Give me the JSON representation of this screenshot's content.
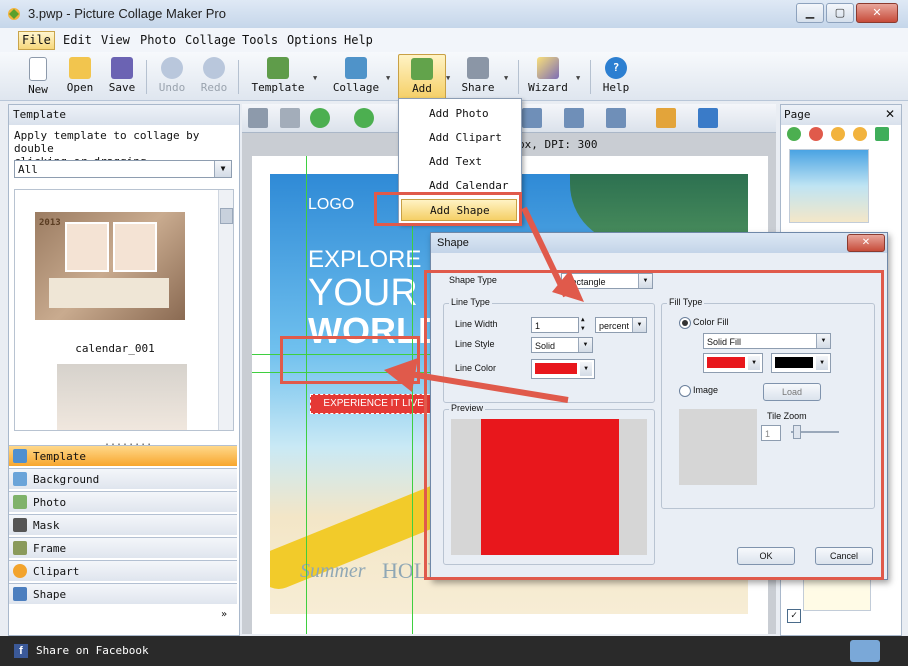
{
  "window": {
    "title": "3.pwp - Picture Collage Maker Pro"
  },
  "menu": [
    "File",
    "Edit",
    "View",
    "Photo",
    "Collage",
    "Tools",
    "Options",
    "Help"
  ],
  "toolbar": {
    "new": "New",
    "open": "Open",
    "save": "Save",
    "undo": "Undo",
    "redo": "Redo",
    "template": "Template",
    "collage": "Collage",
    "add": "Add",
    "share": "Share",
    "wizard": "Wizard",
    "help": "Help"
  },
  "add_menu": [
    "Add Photo",
    "Add Clipart",
    "Add Text",
    "Add Calendar",
    "Add Shape"
  ],
  "left_panel": {
    "header": "Template",
    "description_line1": "Apply template to collage by double",
    "description_line2": "clicking or dragging",
    "filter": "All",
    "thumb_label": "calendar_001",
    "thumb_year": "2013",
    "grip": "........"
  },
  "panel_tabs": [
    "Template",
    "Background",
    "Photo",
    "Mask",
    "Frame",
    "Clipart",
    "Shape"
  ],
  "panel_more": "»",
  "canvas": {
    "dims_text": "px, DPI: 300",
    "logo": "LOGO",
    "explore": "EXPLORE",
    "your": "YOUR",
    "world": "WORLD",
    "banner": "EXPERIENCE IT LIVE!",
    "summer": "Summer",
    "holiday": "HOLIDAY"
  },
  "right_panel": {
    "header": "Page",
    "check": "✓"
  },
  "dialog": {
    "title": "Shape",
    "close": "✕",
    "shape_type_label": "Shape Type",
    "shape_type_value": "Rectangle",
    "line_type_group": "Line Type",
    "line_width_label": "Line Width",
    "line_width_value": "1",
    "line_width_unit": "percent",
    "line_style_label": "Line Style",
    "line_style_value": "Solid",
    "line_color_label": "Line Color",
    "preview_group": "Preview",
    "fill_type_group": "Fill Type",
    "color_fill_label": "Color Fill",
    "fill_style_value": "Solid Fill",
    "image_label": "Image",
    "load_button": "Load",
    "tile_zoom_label": "Tile Zoom",
    "tile_zoom_value": "1",
    "ok_button": "OK",
    "cancel_button": "Cancel"
  },
  "colors": {
    "line_color": "#e8171c",
    "fill_color1": "#e8171c",
    "fill_color2": "#000000",
    "annotation_red": "#e05a4b"
  },
  "status": {
    "share_facebook": "Share on Facebook",
    "fb_glyph": "f"
  }
}
